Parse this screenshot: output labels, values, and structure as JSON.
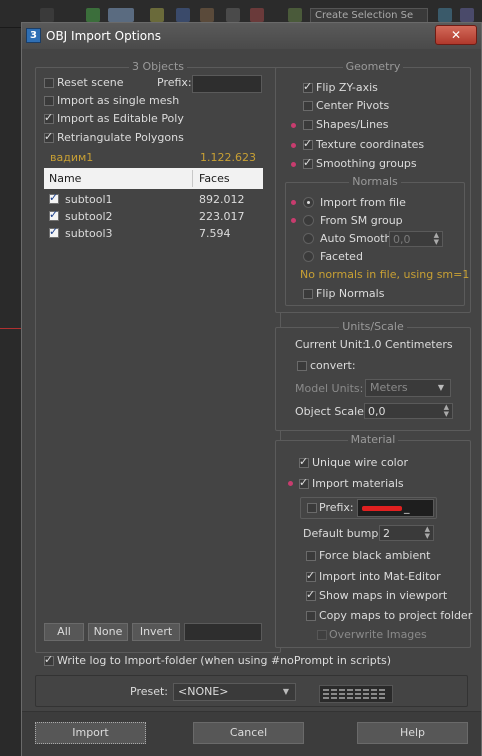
{
  "toolbar": {
    "selection_set_label": "Create Selection Se"
  },
  "dialog": {
    "title": "OBJ Import Options",
    "app_icon": "3",
    "close_label": "✕"
  },
  "objects": {
    "group_title": "3 Objects",
    "reset_scene": "Reset scene",
    "prefix_label": "Prefix:",
    "prefix_value": "",
    "single_mesh": "Import as single mesh",
    "editable_poly": "Import as Editable Poly",
    "retriangulate": "Retriangulate Polygons",
    "summary_name": "вадим1",
    "summary_faces": "1.122.623",
    "columns": [
      "Name",
      "Faces"
    ],
    "rows": [
      {
        "name": "subtool1",
        "faces": "892.012"
      },
      {
        "name": "subtool2",
        "faces": "223.017"
      },
      {
        "name": "subtool3",
        "faces": "7.594"
      }
    ],
    "buttons": {
      "all": "All",
      "none": "None",
      "invert": "Invert"
    },
    "filter_value": ""
  },
  "geometry": {
    "group_title": "Geometry",
    "flip_zy": "Flip ZY-axis",
    "center_pivots": "Center Pivots",
    "shapes_lines": "Shapes/Lines",
    "texture_coords": "Texture coordinates",
    "smoothing_groups": "Smoothing groups"
  },
  "normals": {
    "group_title": "Normals",
    "import_from_file": "Import from file",
    "from_sm_group": "From SM group",
    "auto_smooth": "Auto Smooth:",
    "auto_smooth_value": "0,0",
    "faceted": "Faceted",
    "note": "No normals in file, using sm=1",
    "flip_normals": "Flip Normals"
  },
  "units": {
    "group_title": "Units/Scale",
    "current_unit_label": "Current Unit:",
    "current_unit_value": "1.0 Centimeters",
    "convert": "convert:",
    "model_units_label": "Model Units:",
    "model_units_value": "Meters",
    "object_scale_label": "Object Scale:",
    "object_scale_value": "0,0"
  },
  "material": {
    "group_title": "Material",
    "unique_wire": "Unique wire color",
    "import_materials": "Import materials",
    "prefix_label": "Prefix:",
    "prefix_value": "_",
    "default_bump_label": "Default bump:",
    "default_bump_value": "2",
    "force_black": "Force black ambient",
    "import_mat_editor": "Import into Mat-Editor",
    "show_maps": "Show maps in viewport",
    "copy_maps": "Copy maps to project folder",
    "overwrite_images": "Overwrite Images"
  },
  "footer": {
    "write_log": "Write log to Import-folder (when using #noPrompt in scripts)",
    "preset_label": "Preset:",
    "preset_value": "<NONE>",
    "import_button": "Import",
    "cancel_button": "Cancel",
    "help_button": "Help"
  },
  "colors": {
    "dialog_bg": "#444444",
    "accent_pin": "#c83c6e",
    "summary_text": "#c8a034",
    "close_button": "#b0392c"
  }
}
